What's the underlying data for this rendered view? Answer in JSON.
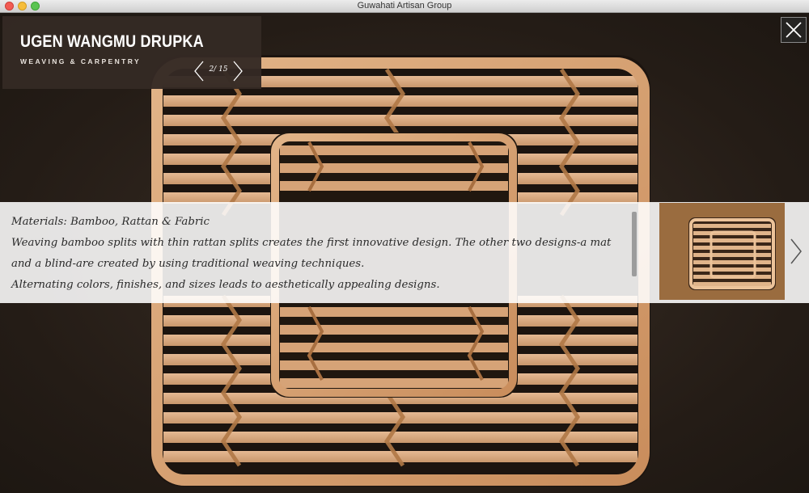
{
  "window": {
    "title": "Guwahati Artisan Group"
  },
  "header": {
    "artist_name": "UGEN WANGMU DRUPKA",
    "craft": "WEAVING & CARPENTRY",
    "counter": "2/ 15"
  },
  "caption": {
    "lines": [
      "Materials: Bamboo, Rattan & Fabric",
      "Weaving bamboo splits with thin rattan splits creates the first innovative design. The other two designs-a mat and a blind-are created by using traditional weaving techniques.",
      "Alternating colors, finishes, and sizes leads to aesthetically appealing designs."
    ]
  },
  "icons": {
    "prev": "chevron-left-icon",
    "next": "chevron-right-icon",
    "close": "close-icon",
    "thumb_next": "chevron-right-icon"
  },
  "colors": {
    "header_bg": "#342a24",
    "background": "#2b221c",
    "bamboo": "#d9a77a"
  }
}
